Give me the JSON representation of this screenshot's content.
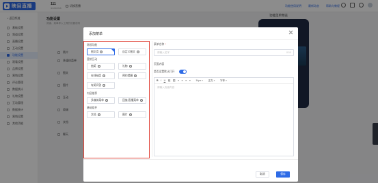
{
  "topbar": {
    "logo_text": "映目直播",
    "account_name": "111",
    "account_id": "ID:3366748",
    "account_tag": "切换直播",
    "links": [
      "功能使用说明",
      "最新动态",
      "帮助与教程"
    ]
  },
  "sidebar": {
    "back": "< 返回频道",
    "items": [
      {
        "label": "基础设置"
      },
      {
        "label": "频道设置"
      },
      {
        "label": "直播设置"
      },
      {
        "label": "互动设置"
      },
      {
        "label": "功能设置"
      },
      {
        "label": "观看设置"
      },
      {
        "label": "品牌设置"
      },
      {
        "label": "营销设置"
      },
      {
        "label": "评论管理"
      },
      {
        "label": "数据统计"
      },
      {
        "label": "礼物设置"
      },
      {
        "label": "互动管理"
      },
      {
        "label": "数据统计"
      },
      {
        "label": "营销设置"
      },
      {
        "label": "其他功能"
      }
    ],
    "active_index": 4
  },
  "main": {
    "title": "功能设置",
    "description": "频道、菜单导入工具的设置说明",
    "rows": [
      "简介",
      "多媒体菜单",
      "图文",
      "图片",
      "互动",
      "商城",
      "文档",
      "聊天"
    ],
    "preview_title": "功能菜单预览"
  },
  "modal": {
    "title": "添加菜单",
    "groups": [
      {
        "title": "常规功能",
        "items": [
          "图文类",
          "自定义图文"
        ],
        "selected": 0
      },
      {
        "title": "营销互动",
        "items": [
          "抽奖",
          "礼物",
          "在线抽奖",
          "预约提醒",
          "有奖问答"
        ]
      },
      {
        "title": "内容推荐",
        "items": [
          "多媒体菜单",
          "回放/直播菜单"
        ]
      },
      {
        "title": "基础组件",
        "items": [
          "文档",
          "图片"
        ]
      }
    ],
    "right": {
      "name_label": "菜单名称",
      "name_placeholder": "请输入名字",
      "name_count": "0/10",
      "content_label": "页面内容",
      "default_label": "是否设置默认打开",
      "toolbar": [
        "B",
        "I",
        "U",
        "链",
        "图",
        "≡",
        "≡",
        "≡",
        "≡",
        "14px",
        "正文",
        "字体"
      ],
      "editor_placeholder": "请输入页面内容"
    },
    "cancel_label": "取消",
    "save_label": "保存"
  }
}
